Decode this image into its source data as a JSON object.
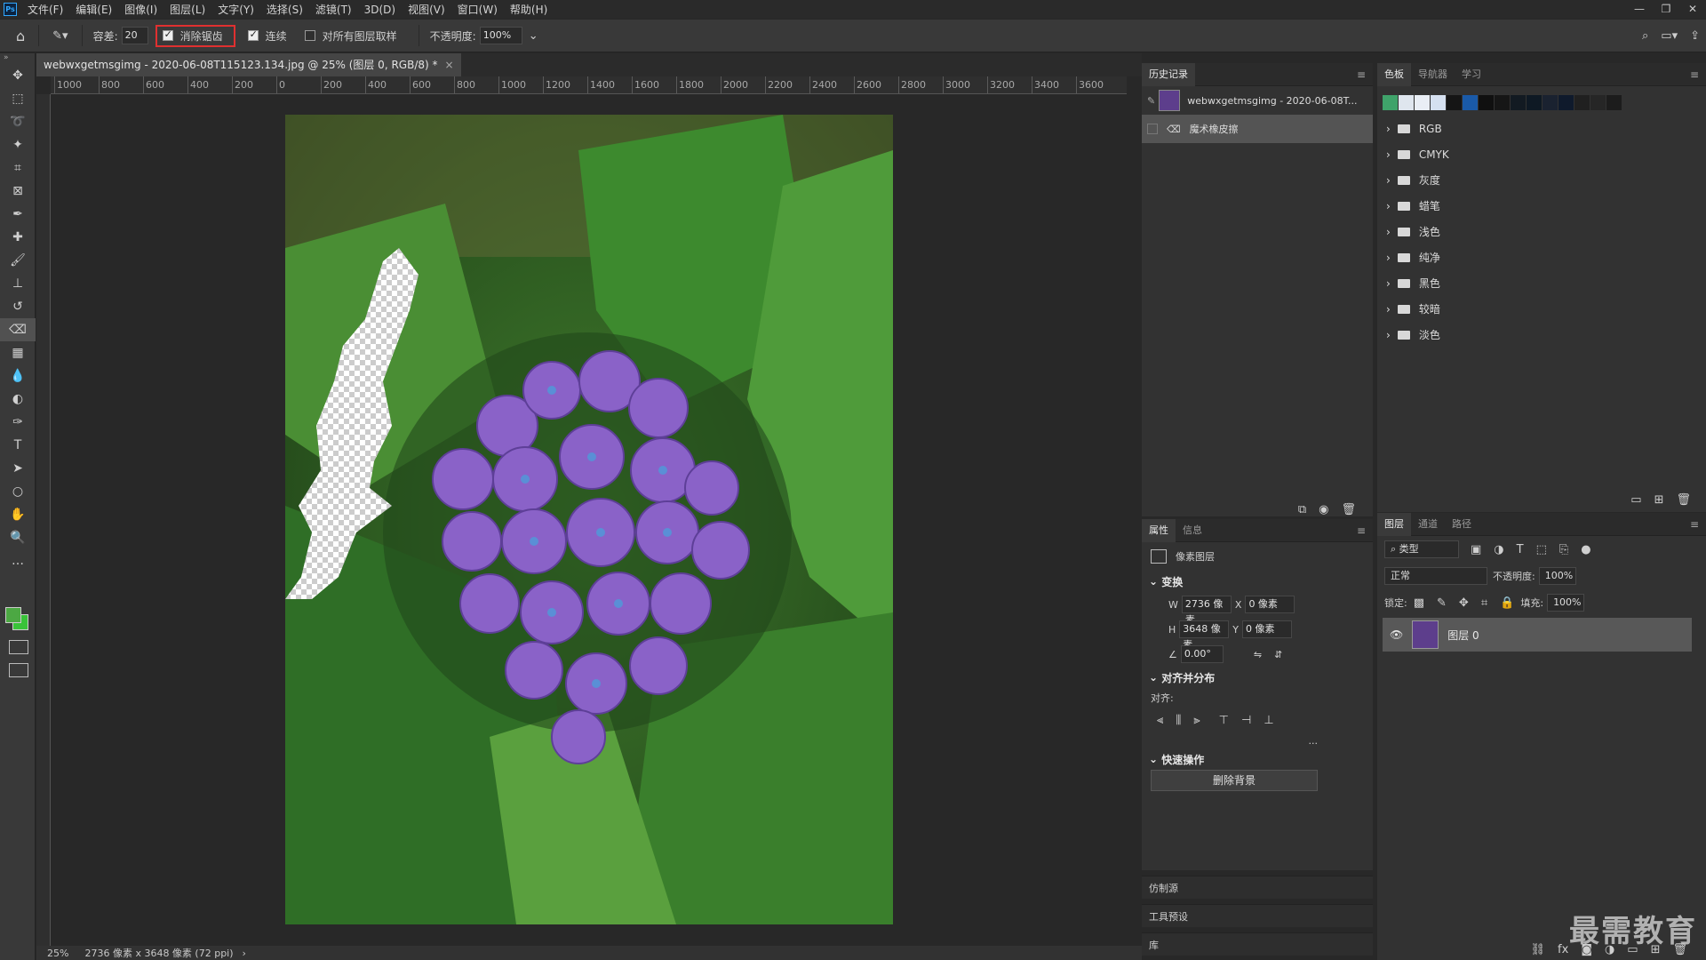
{
  "menubar": {
    "logo": "Ps",
    "items": [
      "文件(F)",
      "编辑(E)",
      "图像(I)",
      "图层(L)",
      "文字(Y)",
      "选择(S)",
      "滤镜(T)",
      "3D(D)",
      "视图(V)",
      "窗口(W)",
      "帮助(H)"
    ],
    "win_controls": [
      "—",
      "❐",
      "✕"
    ]
  },
  "options": {
    "tolerance_label": "容差:",
    "tolerance_value": "20",
    "antialias_label": "消除锯齿",
    "antialias_checked": true,
    "contiguous_label": "连续",
    "contiguous_checked": true,
    "all_layers_label": "对所有图层取样",
    "all_layers_checked": false,
    "opacity_label": "不透明度:",
    "opacity_value": "100%"
  },
  "document": {
    "tab_title": "webwxgetmsgimg - 2020-06-08T115123.134.jpg @ 25% (图层 0, RGB/8) *",
    "close": "×"
  },
  "ruler": {
    "labels": [
      "1000",
      "800",
      "600",
      "400",
      "200",
      "0",
      "200",
      "400",
      "600",
      "800",
      "1000",
      "1200",
      "1400",
      "1600",
      "1800",
      "2000",
      "2200",
      "2400",
      "2600",
      "2800",
      "3000",
      "3200",
      "3400",
      "3600"
    ]
  },
  "status": {
    "zoom": "25%",
    "size_info": "2736 像素 x 3648 像素 (72 ppi)",
    "arrow": "›"
  },
  "history": {
    "tab": "历史记录",
    "doc_name": "webwxgetmsgimg - 2020-06-08T...",
    "step": "魔术橡皮擦"
  },
  "properties": {
    "tabs": [
      "属性",
      "信息"
    ],
    "layer_type": "像素图层",
    "transform_title": "变换",
    "w_label": "W",
    "w_value": "2736 像素",
    "x_label": "X",
    "x_value": "0 像素",
    "h_label": "H",
    "h_value": "3648 像素",
    "y_label": "Y",
    "y_value": "0 像素",
    "angle_value": "0.00°",
    "align_title": "对齐并分布",
    "align_label": "对齐:",
    "more": "...",
    "quick_title": "快速操作",
    "remove_bg": "删除背景"
  },
  "collapsed_panels": [
    "仿制源",
    "工具预设",
    "库"
  ],
  "swatches": {
    "tabs": [
      "色板",
      "导航器",
      "学习"
    ],
    "colors": [
      "#3fa36a",
      "#dfe6ee",
      "#e9eef5",
      "#d5e0f0",
      "#151515",
      "#1a5aa8",
      "#101010",
      "#161616",
      "#121a22",
      "#0e1924",
      "#1a2230",
      "#0f1a2c",
      "#202020",
      "#262626",
      "#1c1c1c"
    ],
    "folders": [
      "RGB",
      "CMYK",
      "灰度",
      "蜡笔",
      "浅色",
      "纯净",
      "黑色",
      "较暗",
      "淡色"
    ]
  },
  "layers": {
    "tabs": [
      "图层",
      "通道",
      "路径"
    ],
    "filter_kind": "类型",
    "blend_mode": "正常",
    "opacity_label": "不透明度:",
    "opacity_value": "100%",
    "lock_label": "锁定:",
    "fill_label": "填充:",
    "fill_value": "100%",
    "layer_name": "图层 0"
  },
  "watermark": "最需教育"
}
